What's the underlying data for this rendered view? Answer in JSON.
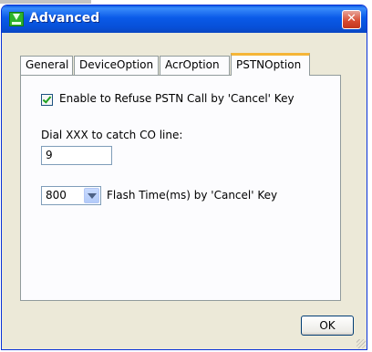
{
  "window": {
    "title": "Advanced"
  },
  "tabs": [
    {
      "label": "General"
    },
    {
      "label": "DeviceOption"
    },
    {
      "label": "AcrOption"
    },
    {
      "label": "PSTNOption"
    }
  ],
  "pstn": {
    "refuse_label": "Enable to Refuse PSTN Call by 'Cancel' Key",
    "refuse_checked": true,
    "dial_label": "Dial XXX to catch CO line:",
    "dial_value": "9",
    "flash_value": "800",
    "flash_label": "Flash Time(ms) by 'Cancel' Key"
  },
  "footer": {
    "ok_label": "OK"
  },
  "colors": {
    "title_bar": "#0a5ae8",
    "active_tab_accent": "#f5b537"
  }
}
